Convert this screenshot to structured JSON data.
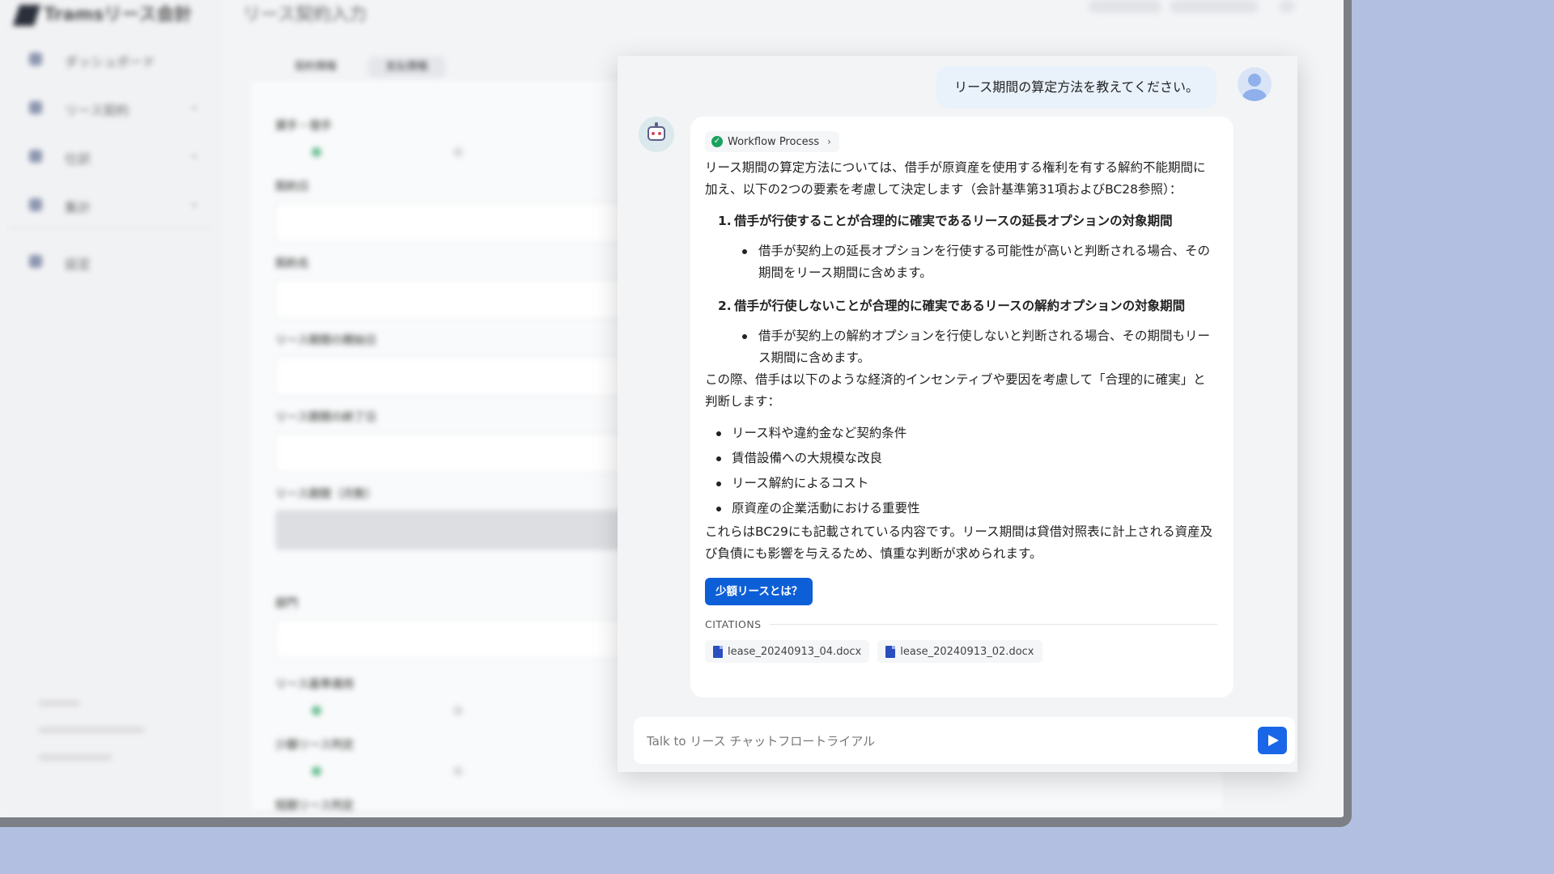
{
  "background_app": {
    "title": "リース契約入力",
    "logo": "Tramsリース会計",
    "nav": [
      "ダッシュボード",
      "リース契約",
      "仕訳",
      "集計",
      "設定"
    ],
    "tabs": [
      "契約情報",
      "支払情報"
    ],
    "fields": [
      "貸手・借手",
      "契約日",
      "契約名",
      "リース期間の開始日",
      "リース期間の終了日",
      "リース期間（月数）",
      "部門",
      "リース基準適用",
      "少額リース判定",
      "短期リース判定"
    ]
  },
  "chat": {
    "user_message": "リース期間の算定方法を教えてください。",
    "workflow_label": "Workflow Process",
    "answer": {
      "intro": "リース期間の算定方法については、借手が原資産を使用する権利を有する解約不能期間に加え、以下の2つの要素を考慮して決定します（会計基準第31項およびBC28参照）：",
      "items": [
        {
          "num": "1.",
          "heading": "借手が行使することが合理的に確実であるリースの延長オプションの対象期間",
          "detail": "借手が契約上の延長オプションを行使する可能性が高いと判断される場合、その期間をリース期間に含めます。"
        },
        {
          "num": "2.",
          "heading": "借手が行使しないことが合理的に確実であるリースの解約オプションの対象期間",
          "detail": "借手が契約上の解約オプションを行使しないと判断される場合、その期間もリース期間に含めます。"
        }
      ],
      "middle": "この際、借手は以下のような経済的インセンティブや要因を考慮して「合理的に確実」と判断します：",
      "factors": [
        "リース料や違約金など契約条件",
        "賃借設備への大規模な改良",
        "リース解約によるコスト",
        "原資産の企業活動における重要性"
      ],
      "closing": "これらはBC29にも記載されている内容です。リース期間は貸借対照表に計上される資産及び負債にも影響を与えるため、慎重な判断が求められます。"
    },
    "suggestion": "少額リースとは？",
    "citations_label": "CITATIONS",
    "citations": [
      "lease_20240913_04.docx",
      "lease_20240913_02.docx"
    ],
    "input_placeholder": "Talk to リース チャットフロートライアル"
  }
}
